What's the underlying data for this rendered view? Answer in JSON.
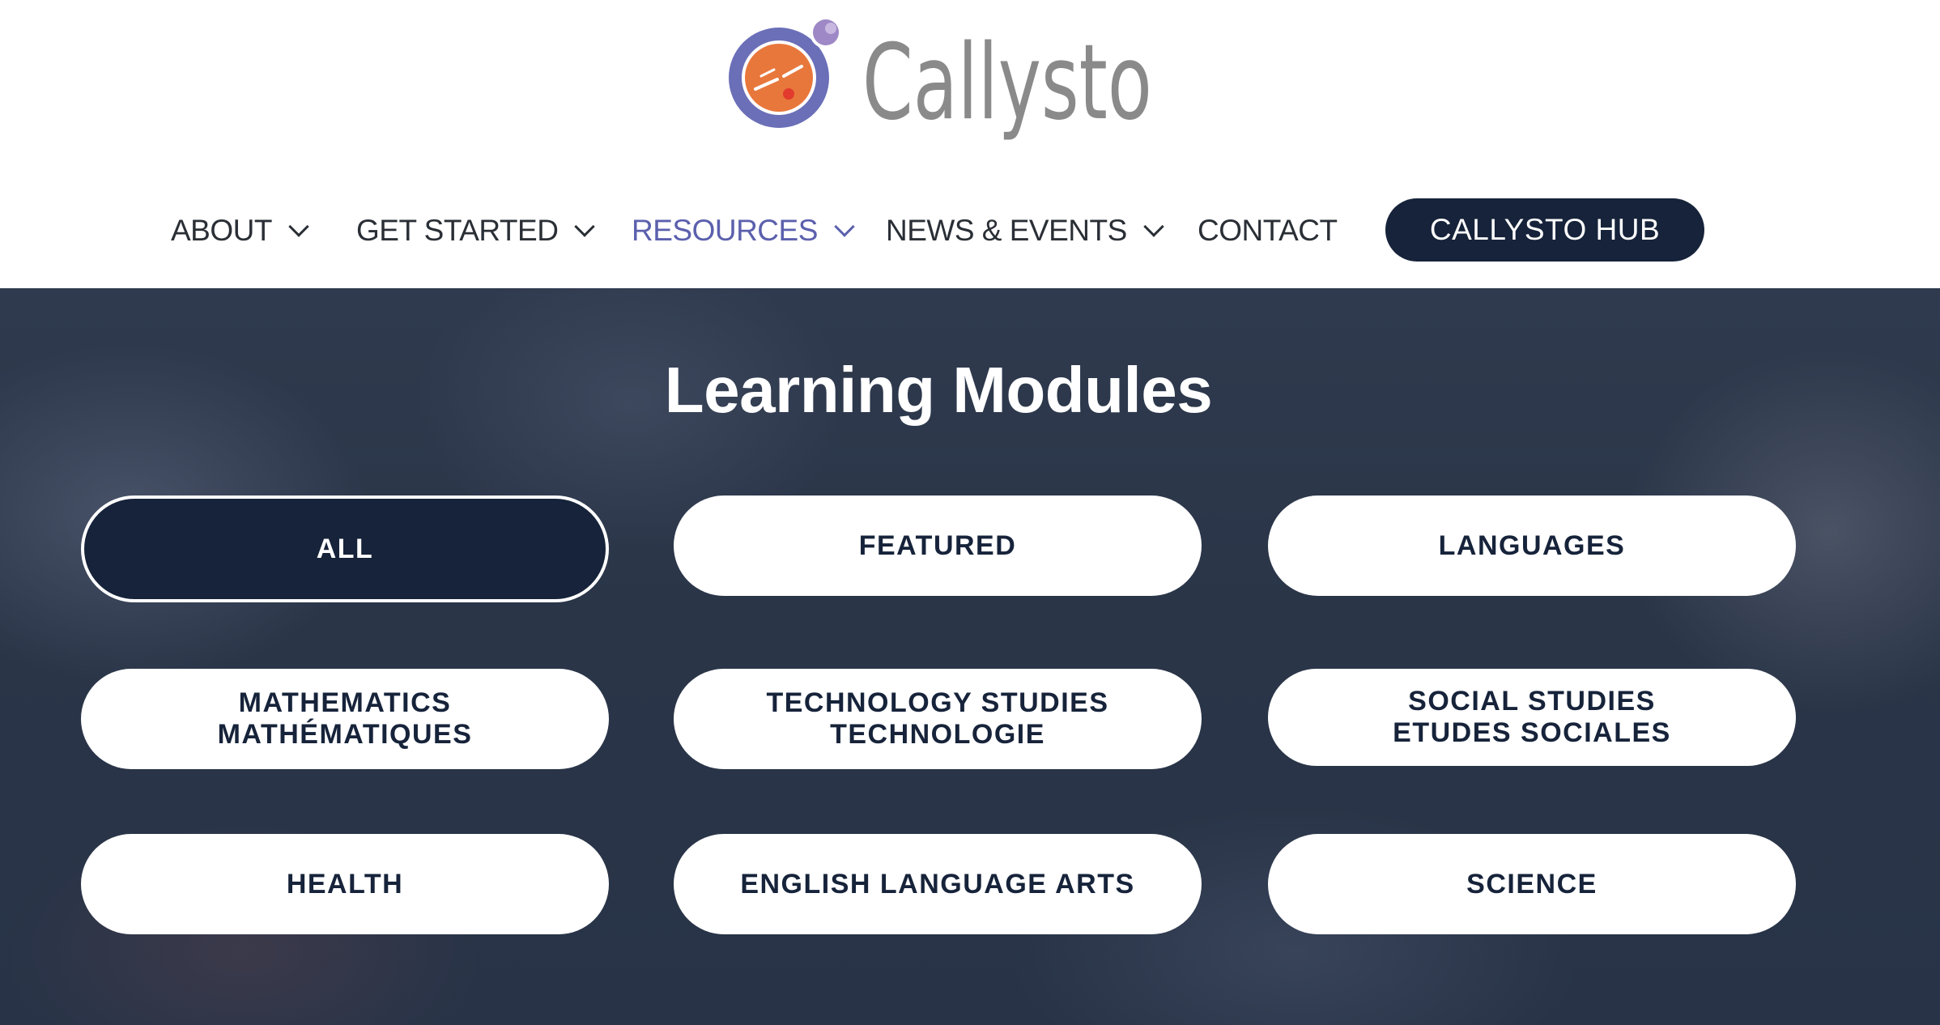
{
  "brand": {
    "name": "Callysto",
    "logo_icon": "callysto-planet-logo",
    "colors": {
      "ring": "#6b6fb8",
      "planet": "#e8773c",
      "moon": "#9e88c6",
      "text": "#8a8a8a"
    }
  },
  "nav": {
    "items": [
      {
        "label": "ABOUT",
        "has_dropdown": true
      },
      {
        "label": "GET STARTED",
        "has_dropdown": true
      },
      {
        "label": "RESOURCES",
        "has_dropdown": true,
        "active": true
      },
      {
        "label": "NEWS & EVENTS",
        "has_dropdown": true
      },
      {
        "label": "CONTACT",
        "has_dropdown": false
      }
    ],
    "cta": {
      "label": "CALLYSTO HUB"
    },
    "active_color": "#5b60ad",
    "cta_color": "#16233a"
  },
  "hero": {
    "title": "Learning Modules",
    "filters": [
      {
        "lines": [
          "ALL"
        ],
        "selected": true
      },
      {
        "lines": [
          "FEATURED"
        ]
      },
      {
        "lines": [
          "LANGUAGES"
        ]
      },
      {
        "lines": [
          "MATHEMATICS",
          "MATHÉMATIQUES"
        ]
      },
      {
        "lines": [
          "TECHNOLOGY STUDIES",
          "TECHNOLOGIE"
        ]
      },
      {
        "lines": [
          "SOCIAL STUDIES",
          "ETUDES SOCIALES"
        ]
      },
      {
        "lines": [
          "HEALTH"
        ]
      },
      {
        "lines": [
          "ENGLISH LANGUAGE ARTS"
        ]
      },
      {
        "lines": [
          "SCIENCE"
        ]
      }
    ]
  }
}
